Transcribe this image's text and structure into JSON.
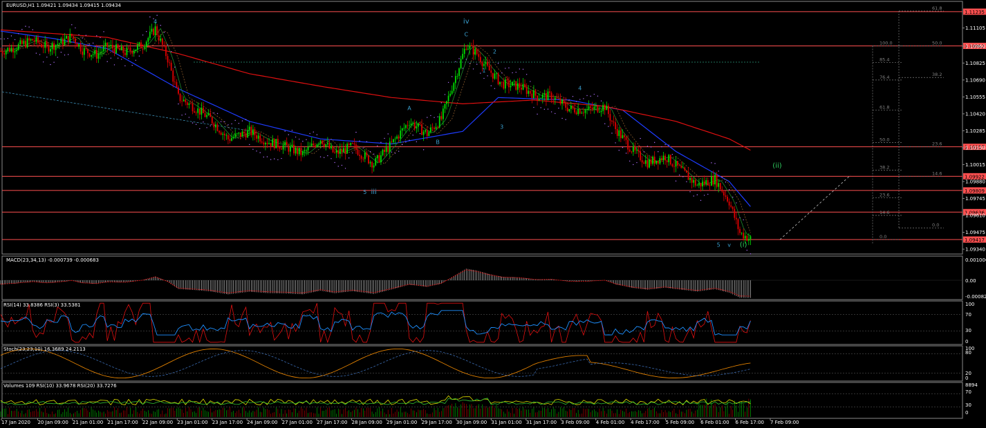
{
  "window": {
    "title": "EURUSD,H1  1.09421 1.09434 1.09415 1.09434"
  },
  "colors": {
    "background": "#000000",
    "bull_candle": "#00e000",
    "bear_candle": "#e00000",
    "ma_blue": "#1e3cff",
    "ma_red": "#e01010",
    "hline": "#ff5050",
    "fib": "#808080",
    "wave_label": "#3aa0d0",
    "wave_label_green": "#30d060",
    "macd_hist": "#c0c0c0",
    "rsi_red": "#e01010",
    "rsi_blue": "#1e90ff",
    "stoch_orange": "#e08000",
    "volume_green": "#00c000",
    "volume_red": "#c00000",
    "volume_yellow": "#e0e000",
    "axis_text": "#ffffff",
    "grid": "#505050"
  },
  "chart_data": {
    "type": "line",
    "symbol": "EURUSD",
    "timeframe": "H1",
    "ohlc_last": {
      "open": 1.09421,
      "high": 1.09434,
      "low": 1.09415,
      "close": 1.09434
    },
    "x_tick_labels": [
      "17 Jan 2020",
      "20 Jan 09:00",
      "21 Jan 01:00",
      "21 Jan 17:00",
      "22 Jan 09:00",
      "23 Jan 01:00",
      "23 Jan 17:00",
      "24 Jan 09:00",
      "27 Jan 01:00",
      "27 Jan 17:00",
      "28 Jan 09:00",
      "29 Jan 01:00",
      "29 Jan 17:00",
      "30 Jan 09:00",
      "31 Jan 01:00",
      "31 Jan 17:00",
      "3 Feb 09:00",
      "4 Feb 01:00",
      "4 Feb 17:00",
      "5 Feb 09:00",
      "6 Feb 01:00",
      "6 Feb 17:00",
      "7 Feb 09:00"
    ],
    "y_tick_labels": [
      "1.11105",
      "1.10960",
      "1.10825",
      "1.10690",
      "1.10555",
      "1.10420",
      "1.10285",
      "1.10150",
      "1.10015",
      "1.09880",
      "1.09745",
      "1.09610",
      "1.09475",
      "1.09340"
    ],
    "ylim": [
      1.0934,
      1.1124
    ],
    "price_path": [
      [
        0,
        1.1092
      ],
      [
        8,
        1.1095
      ],
      [
        18,
        1.1101
      ],
      [
        26,
        1.1095
      ],
      [
        34,
        1.1099
      ],
      [
        40,
        1.1104
      ],
      [
        46,
        1.1093
      ],
      [
        54,
        1.1089
      ],
      [
        60,
        1.1096
      ],
      [
        70,
        1.1091
      ],
      [
        80,
        1.1097
      ],
      [
        87,
        1.111
      ],
      [
        94,
        1.1086
      ],
      [
        100,
        1.1055
      ],
      [
        108,
        1.1048
      ],
      [
        118,
        1.1038
      ],
      [
        128,
        1.1022
      ],
      [
        140,
        1.1028
      ],
      [
        150,
        1.102
      ],
      [
        160,
        1.1016
      ],
      [
        170,
        1.101
      ],
      [
        180,
        1.1022
      ],
      [
        188,
        1.101
      ],
      [
        198,
        1.1016
      ],
      [
        210,
        1.1002
      ],
      [
        220,
        1.1018
      ],
      [
        230,
        1.1036
      ],
      [
        240,
        1.1026
      ],
      [
        248,
        1.1038
      ],
      [
        256,
        1.1072
      ],
      [
        262,
        1.1097
      ],
      [
        268,
        1.109
      ],
      [
        274,
        1.1078
      ],
      [
        282,
        1.1066
      ],
      [
        292,
        1.1064
      ],
      [
        302,
        1.1056
      ],
      [
        310,
        1.1056
      ],
      [
        320,
        1.1046
      ],
      [
        330,
        1.1045
      ],
      [
        340,
        1.1048
      ],
      [
        346,
        1.103
      ],
      [
        356,
        1.1012
      ],
      [
        364,
        1.1003
      ],
      [
        374,
        1.1008
      ],
      [
        382,
        1.0998
      ],
      [
        392,
        1.0985
      ],
      [
        402,
        1.099
      ],
      [
        410,
        1.0972
      ],
      [
        416,
        1.0947
      ],
      [
        422,
        1.0942
      ]
    ],
    "moving_averages": [
      {
        "color": "blue",
        "values": [
          [
            0,
            1.1108
          ],
          [
            30,
            1.1102
          ],
          [
            60,
            1.1094
          ],
          [
            100,
            1.1062
          ],
          [
            140,
            1.1036
          ],
          [
            180,
            1.1022
          ],
          [
            220,
            1.1018
          ],
          [
            260,
            1.1028
          ],
          [
            280,
            1.1055
          ],
          [
            320,
            1.1053
          ],
          [
            350,
            1.1045
          ],
          [
            380,
            1.1012
          ],
          [
            410,
            1.0988
          ],
          [
            422,
            1.0968
          ]
        ]
      },
      {
        "color": "red",
        "values": [
          [
            0,
            1.1109
          ],
          [
            60,
            1.1103
          ],
          [
            100,
            1.109
          ],
          [
            140,
            1.1074
          ],
          [
            180,
            1.1064
          ],
          [
            220,
            1.1055
          ],
          [
            260,
            1.105
          ],
          [
            300,
            1.1053
          ],
          [
            340,
            1.1048
          ],
          [
            380,
            1.1036
          ],
          [
            410,
            1.1022
          ],
          [
            422,
            1.1013
          ]
        ]
      }
    ],
    "horizontal_levels": [
      {
        "label": "1.11235",
        "value": 1.11235
      },
      {
        "label": "1.10962",
        "value": 1.10962
      },
      {
        "label": "1.10157",
        "value": 1.10157
      },
      {
        "label": "1.09922",
        "value": 1.09922
      },
      {
        "label": "1.09809",
        "value": 1.09809
      },
      {
        "label": "1.09636",
        "value": 1.09636
      },
      {
        "label": "1.09417",
        "value": 1.09417
      }
    ],
    "fib_levels": [
      {
        "label": "100.0",
        "value": 1.10962
      },
      {
        "label": "85.4",
        "value": 1.1083
      },
      {
        "label": "76.4",
        "value": 1.1069
      },
      {
        "label": "61.8",
        "value": 1.1045
      },
      {
        "label": "50.0",
        "value": 1.1019
      },
      {
        "label": "38.2",
        "value": 1.0997
      },
      {
        "label": "23.6",
        "value": 1.0975
      },
      {
        "label": "14.6",
        "value": 1.0961
      },
      {
        "label": "0.0",
        "value": 1.09417
      }
    ],
    "fib_right_levels": [
      {
        "label": "61.8",
        "value": 1.1124
      },
      {
        "label": "50.0",
        "value": 1.10962
      },
      {
        "label": "38.2",
        "value": 1.1071
      },
      {
        "label": "23.6",
        "value": 1.10157
      },
      {
        "label": "14.6",
        "value": 1.09922
      },
      {
        "label": "0.0",
        "value": 1.0951
      }
    ],
    "wave_labels": [
      {
        "text": "4",
        "x": 87,
        "y": 1.1114,
        "color": "blue"
      },
      {
        "text": "iv",
        "x": 262,
        "y": 1.1114,
        "color": "blue"
      },
      {
        "text": "C",
        "x": 262,
        "y": 1.1104,
        "color": "blue"
      },
      {
        "text": "2",
        "x": 278,
        "y": 1.109,
        "color": "blue"
      },
      {
        "text": "1",
        "x": 272,
        "y": 1.1075,
        "color": "blue"
      },
      {
        "text": "A",
        "x": 230,
        "y": 1.1045,
        "color": "blue"
      },
      {
        "text": "B",
        "x": 246,
        "y": 1.1018,
        "color": "blue"
      },
      {
        "text": "3",
        "x": 282,
        "y": 1.103,
        "color": "blue"
      },
      {
        "text": "4",
        "x": 326,
        "y": 1.1061,
        "color": "blue"
      },
      {
        "text": "5",
        "x": 205,
        "y": 1.0978,
        "color": "blue"
      },
      {
        "text": "iii",
        "x": 210,
        "y": 1.0978,
        "color": "blue"
      },
      {
        "text": "5",
        "x": 404,
        "y": 1.0936,
        "color": "blue"
      },
      {
        "text": "v",
        "x": 410,
        "y": 1.0936,
        "color": "blue"
      },
      {
        "text": "(i)",
        "x": 418,
        "y": 1.0936,
        "color": "green"
      },
      {
        "text": "(ii)",
        "x": 437,
        "y": 1.0999,
        "color": "green"
      }
    ]
  },
  "indicators": {
    "macd": {
      "label": "MACD(23,34,13) -0.000739 -0.000683",
      "ticks": [
        "0.001006",
        "0.00",
        "-0.000822"
      ]
    },
    "rsi": {
      "label": "RSI(14) 33.8386  RSI(3) 33.5381",
      "ticks": [
        "100",
        "70",
        "30",
        "0"
      ]
    },
    "stoch": {
      "label": "Stoch(23,23,10) 16.3689 24.2113",
      "ticks": [
        "100",
        "80",
        "20",
        "0"
      ]
    },
    "volumes": {
      "label": "Volumes 109  RSI(10) 33.9678  RSI(20) 33.7276",
      "ticks": [
        "8894",
        "70",
        "30",
        "0"
      ]
    }
  }
}
